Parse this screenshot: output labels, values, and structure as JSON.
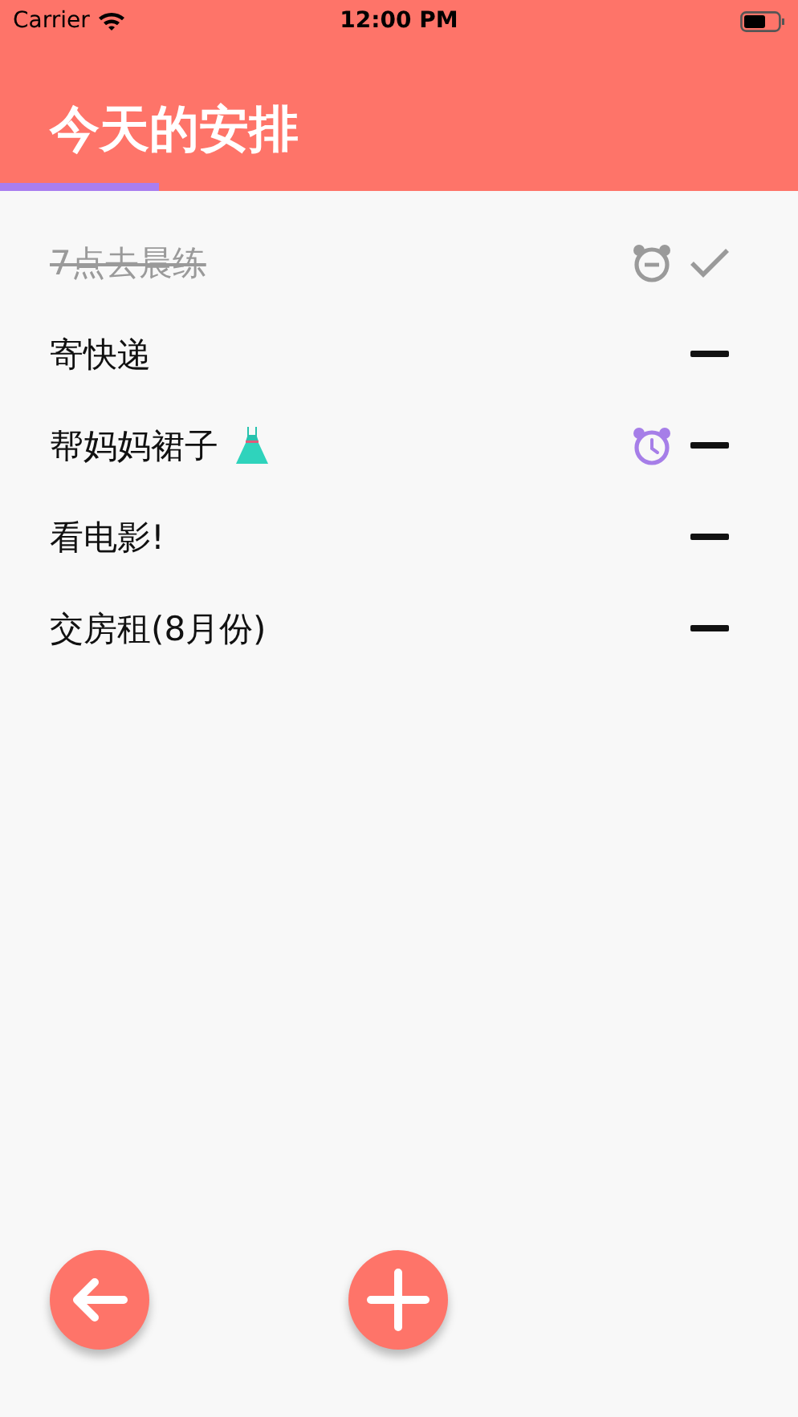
{
  "status_bar": {
    "carrier": "Carrier",
    "time": "12:00 PM"
  },
  "header": {
    "title": "今天的安排",
    "progress": {
      "level": 0.2
    }
  },
  "tasks": [
    {
      "kind": "plain",
      "text": "7点去晨练",
      "done": true,
      "alarm": true,
      "alarm_active": false
    },
    {
      "kind": "plain",
      "text": "寄快递",
      "done": false,
      "alarm": false
    },
    {
      "kind": "dress",
      "text": "帮妈妈裙子",
      "done": false,
      "alarm": true,
      "alarm_active": true
    },
    {
      "kind": "plain",
      "text": "看电影!",
      "done": false,
      "alarm": false
    },
    {
      "kind": "plain",
      "text": "交房租(8月份)",
      "done": false,
      "alarm": false
    }
  ],
  "actions": [
    {
      "kind": "back"
    },
    {
      "kind": "add"
    }
  ]
}
